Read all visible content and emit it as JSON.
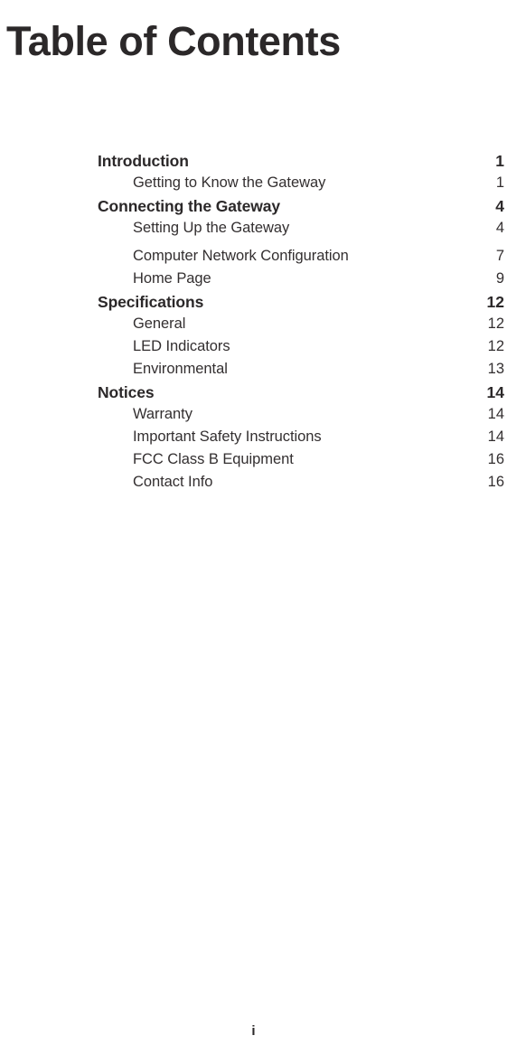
{
  "document": {
    "title": "Table of Contents",
    "folio": "i",
    "text_color": "#332f30",
    "heading_color": "#2b2829",
    "background": "#ffffff"
  },
  "toc": {
    "entries": [
      {
        "label": "Introduction",
        "page": "1",
        "level": 1,
        "gap_before": false
      },
      {
        "label": "Getting to Know the Gateway",
        "page": "1",
        "level": 2,
        "gap_before": false
      },
      {
        "label": "Connecting the Gateway",
        "page": "4",
        "level": 1,
        "gap_before": false
      },
      {
        "label": "Setting Up the Gateway",
        "page": "4",
        "level": 2,
        "gap_before": false
      },
      {
        "label": "Computer Network Configuration",
        "page": "7",
        "level": 2,
        "gap_before": true
      },
      {
        "label": "Home Page",
        "page": "9",
        "level": 2,
        "gap_before": false
      },
      {
        "label": "Specifications",
        "page": "12",
        "level": 1,
        "gap_before": false
      },
      {
        "label": "General",
        "page": "12",
        "level": 2,
        "gap_before": false
      },
      {
        "label": "LED Indicators",
        "page": "12",
        "level": 2,
        "gap_before": false
      },
      {
        "label": "Environmental",
        "page": "13",
        "level": 2,
        "gap_before": false
      },
      {
        "label": "Notices",
        "page": "14",
        "level": 1,
        "gap_before": false
      },
      {
        "label": "Warranty",
        "page": "14",
        "level": 2,
        "gap_before": false
      },
      {
        "label": "Important Safety Instructions",
        "page": "14",
        "level": 2,
        "gap_before": false
      },
      {
        "label": "FCC Class B Equipment",
        "page": "16",
        "level": 2,
        "gap_before": false
      },
      {
        "label": "Contact Info",
        "page": "16",
        "level": 2,
        "gap_before": false
      }
    ]
  }
}
